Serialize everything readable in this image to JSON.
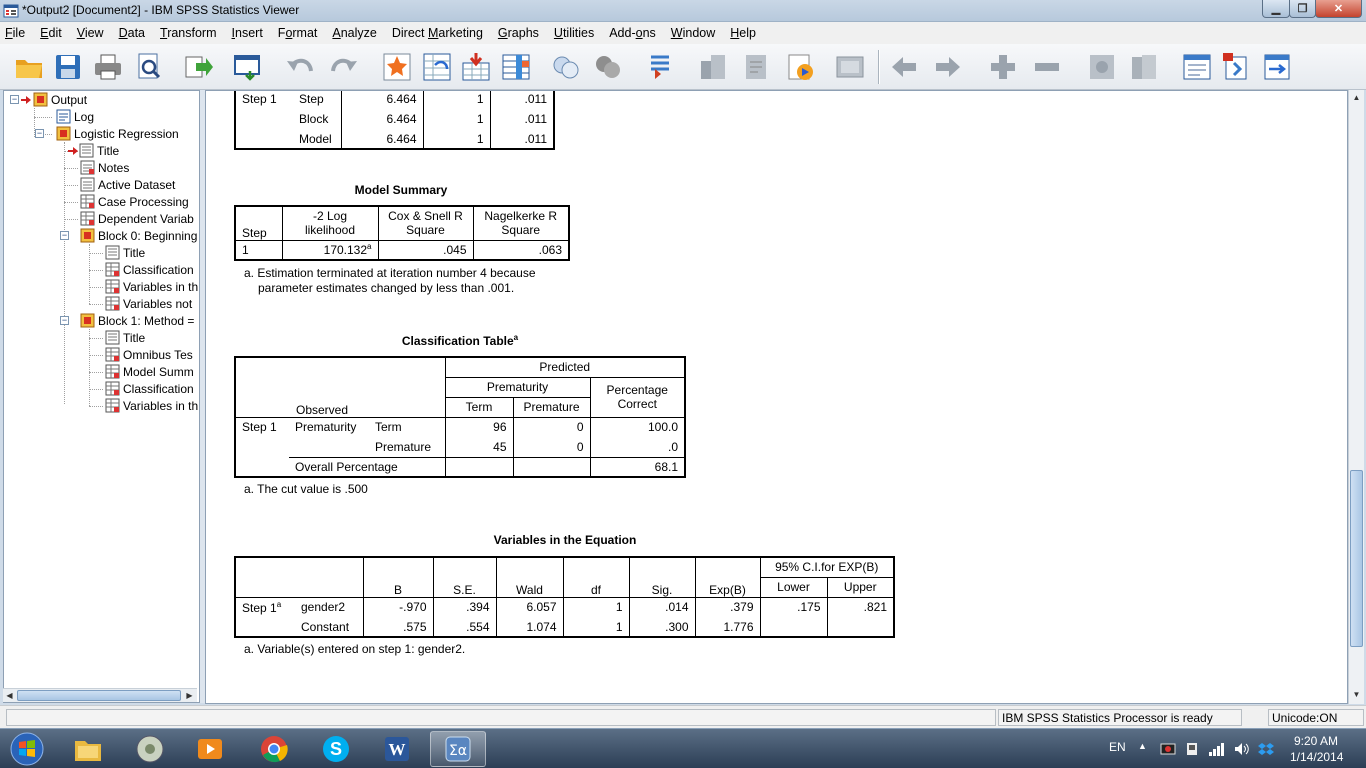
{
  "window": {
    "title": "*Output2 [Document2] - IBM SPSS Statistics Viewer",
    "min_glyph": "▁",
    "max_glyph": "❐",
    "close_glyph": "✕"
  },
  "menu": [
    {
      "pre": "",
      "ul": "F",
      "post": "ile"
    },
    {
      "pre": "",
      "ul": "E",
      "post": "dit"
    },
    {
      "pre": "",
      "ul": "V",
      "post": "iew"
    },
    {
      "pre": "",
      "ul": "D",
      "post": "ata"
    },
    {
      "pre": "",
      "ul": "T",
      "post": "ransform"
    },
    {
      "pre": "",
      "ul": "I",
      "post": "nsert"
    },
    {
      "pre": "F",
      "ul": "o",
      "post": "rmat"
    },
    {
      "pre": "",
      "ul": "A",
      "post": "nalyze"
    },
    {
      "pre": "Direct ",
      "ul": "M",
      "post": "arketing"
    },
    {
      "pre": "",
      "ul": "G",
      "post": "raphs"
    },
    {
      "pre": "",
      "ul": "U",
      "post": "tilities"
    },
    {
      "pre": "Add-",
      "ul": "o",
      "post": "ns"
    },
    {
      "pre": "",
      "ul": "W",
      "post": "indow"
    },
    {
      "pre": "",
      "ul": "H",
      "post": "elp"
    }
  ],
  "nav_tree": {
    "items": [
      {
        "label": "Output"
      },
      {
        "label": "Log"
      },
      {
        "label": "Logistic Regression"
      },
      {
        "label": "Title"
      },
      {
        "label": "Notes"
      },
      {
        "label": "Active Dataset"
      },
      {
        "label": "Case Processing"
      },
      {
        "label": "Dependent Variab"
      },
      {
        "label": "Block 0: Beginning"
      },
      {
        "label": "Title"
      },
      {
        "label": "Classification"
      },
      {
        "label": "Variables in th"
      },
      {
        "label": "Variables not"
      },
      {
        "label": "Block 1: Method ="
      },
      {
        "label": "Title"
      },
      {
        "label": "Omnibus Tes"
      },
      {
        "label": "Model Summ"
      },
      {
        "label": "Classification"
      },
      {
        "label": "Variables in th"
      }
    ],
    "expand_minus": "−",
    "arrow_left": "◀",
    "arrow_right": "▶"
  },
  "omnibus_partial": {
    "rows": [
      {
        "step": "Step 1",
        "label": "Step",
        "chi": "6.464",
        "df": "1",
        "sig": ".011"
      },
      {
        "step": "",
        "label": "Block",
        "chi": "6.464",
        "df": "1",
        "sig": ".011"
      },
      {
        "step": "",
        "label": "Model",
        "chi": "6.464",
        "df": "1",
        "sig": ".011"
      }
    ]
  },
  "model_summary": {
    "title": "Model Summary",
    "headers": {
      "step": "Step",
      "ll_1": "-2 Log",
      "ll_2": "likelihood",
      "cs_1": "Cox & Snell R",
      "cs_2": "Square",
      "nk_1": "Nagelkerke R",
      "nk_2": "Square"
    },
    "row": {
      "step": "1",
      "ll": "170.132",
      "ll_sup": "a",
      "cs": ".045",
      "nk": ".063"
    },
    "footnote_1": "a. Estimation terminated at iteration number 4 because",
    "footnote_2": "parameter estimates changed by less than .001."
  },
  "classification_table": {
    "title": "Classification Table",
    "title_sup": "a",
    "headers": {
      "predicted": "Predicted",
      "prematurity": "Prematurity",
      "pct_1": "Percentage",
      "pct_2": "Correct",
      "observed": "Observed",
      "term": "Term",
      "premature": "Premature"
    },
    "rows": [
      {
        "step": "Step 1",
        "var": "Prematurity",
        "cat": "Term",
        "term": "96",
        "premature": "0",
        "pct": "100.0"
      },
      {
        "step": "",
        "var": "",
        "cat": "Premature",
        "term": "45",
        "premature": "0",
        "pct": ".0"
      }
    ],
    "overall_label": "Overall Percentage",
    "overall_pct": "68.1",
    "footnote": "a. The cut value is .500"
  },
  "variables_equation": {
    "title": "Variables in the Equation",
    "headers": {
      "b": "B",
      "se": "S.E.",
      "wald": "Wald",
      "df": "df",
      "sig": "Sig.",
      "expb": "Exp(B)",
      "ci": "95% C.I.for EXP(B)",
      "lower": "Lower",
      "upper": "Upper"
    },
    "rows": [
      {
        "step": "Step 1",
        "step_sup": "a",
        "var": "gender2",
        "b": "-.970",
        "se": ".394",
        "wald": "6.057",
        "df": "1",
        "sig": ".014",
        "expb": ".379",
        "lower": ".175",
        "upper": ".821"
      },
      {
        "step": "",
        "step_sup": "",
        "var": "Constant",
        "b": ".575",
        "se": ".554",
        "wald": "1.074",
        "df": "1",
        "sig": ".300",
        "expb": "1.776",
        "lower": "",
        "upper": ""
      }
    ],
    "footnote": "a. Variable(s) entered on step 1: gender2."
  },
  "scroll": {
    "up": "▲",
    "down": "▼"
  },
  "statusbar": {
    "processor": "IBM SPSS Statistics Processor is ready",
    "unicode": "Unicode:ON"
  },
  "taskbar": {
    "language": "EN",
    "tray_arrow": "▲",
    "time": "9:20 AM",
    "date": "1/14/2014"
  }
}
